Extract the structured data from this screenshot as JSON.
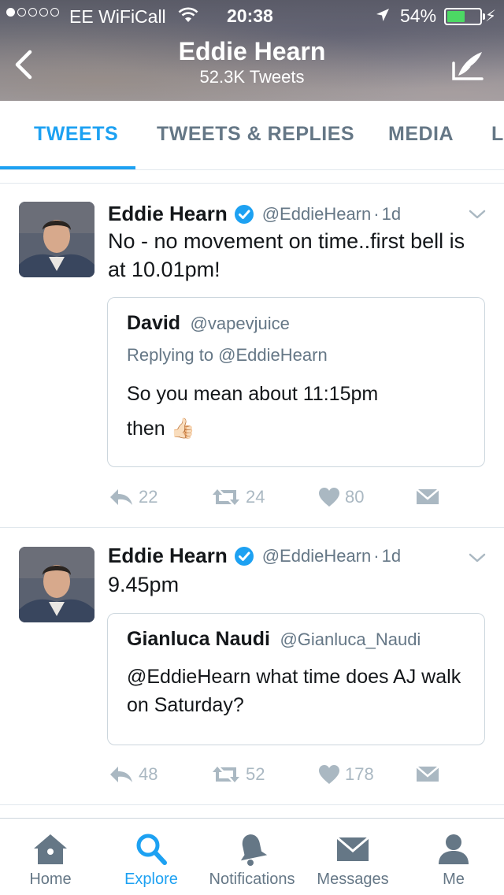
{
  "status_bar": {
    "carrier": "EE WiFiCall",
    "time": "20:38",
    "battery_percent": "54%",
    "battery_level": 0.54,
    "battery_color": "#4cd964",
    "icons": [
      "signal-dots-icon",
      "wifi-icon",
      "location-arrow-icon",
      "battery-icon",
      "charging-bolt-icon"
    ]
  },
  "header": {
    "title": "Eddie Hearn",
    "subtitle": "52.3K Tweets",
    "back_icon": "chevron-left-icon",
    "compose_icon": "compose-tweet-icon"
  },
  "tabs": [
    {
      "label": "TWEETS",
      "active": true
    },
    {
      "label": "TWEETS & REPLIES",
      "active": false
    },
    {
      "label": "MEDIA",
      "active": false
    },
    {
      "label": "L",
      "active": false
    }
  ],
  "tweets": [
    {
      "name": "Eddie Hearn",
      "handle": "@EddieHearn",
      "separator": "·",
      "time": "1d",
      "verified": true,
      "text": "No - no movement on time..first bell is at 10.01pm!",
      "quote": {
        "name": "David",
        "handle": "@vapevjuice",
        "replying": "Replying to @EddieHearn",
        "text_line1": "So you mean about 11:15pm",
        "text_line2": "then",
        "emoji": "👍🏻"
      },
      "replies": "22",
      "retweets": "24",
      "likes": "80"
    },
    {
      "name": "Eddie Hearn",
      "handle": "@EddieHearn",
      "separator": "·",
      "time": "1d",
      "verified": true,
      "text": "9.45pm",
      "quote": {
        "name": "Gianluca Naudi",
        "handle": "@Gianluca_Naudi",
        "text": "@EddieHearn what time does AJ walk on Saturday?"
      },
      "replies": "48",
      "retweets": "52",
      "likes": "178"
    }
  ],
  "bottom_nav": [
    {
      "label": "Home",
      "icon": "home-icon",
      "active": false
    },
    {
      "label": "Explore",
      "icon": "search-icon",
      "active": true
    },
    {
      "label": "Notifications",
      "icon": "bell-icon",
      "active": false
    },
    {
      "label": "Messages",
      "icon": "envelope-icon",
      "active": false
    },
    {
      "label": "Me",
      "icon": "person-icon",
      "active": false
    }
  ],
  "colors": {
    "accent": "#1da1f2",
    "muted": "#657786",
    "action_gray": "#aab8c2",
    "border": "#e1e8ed"
  }
}
